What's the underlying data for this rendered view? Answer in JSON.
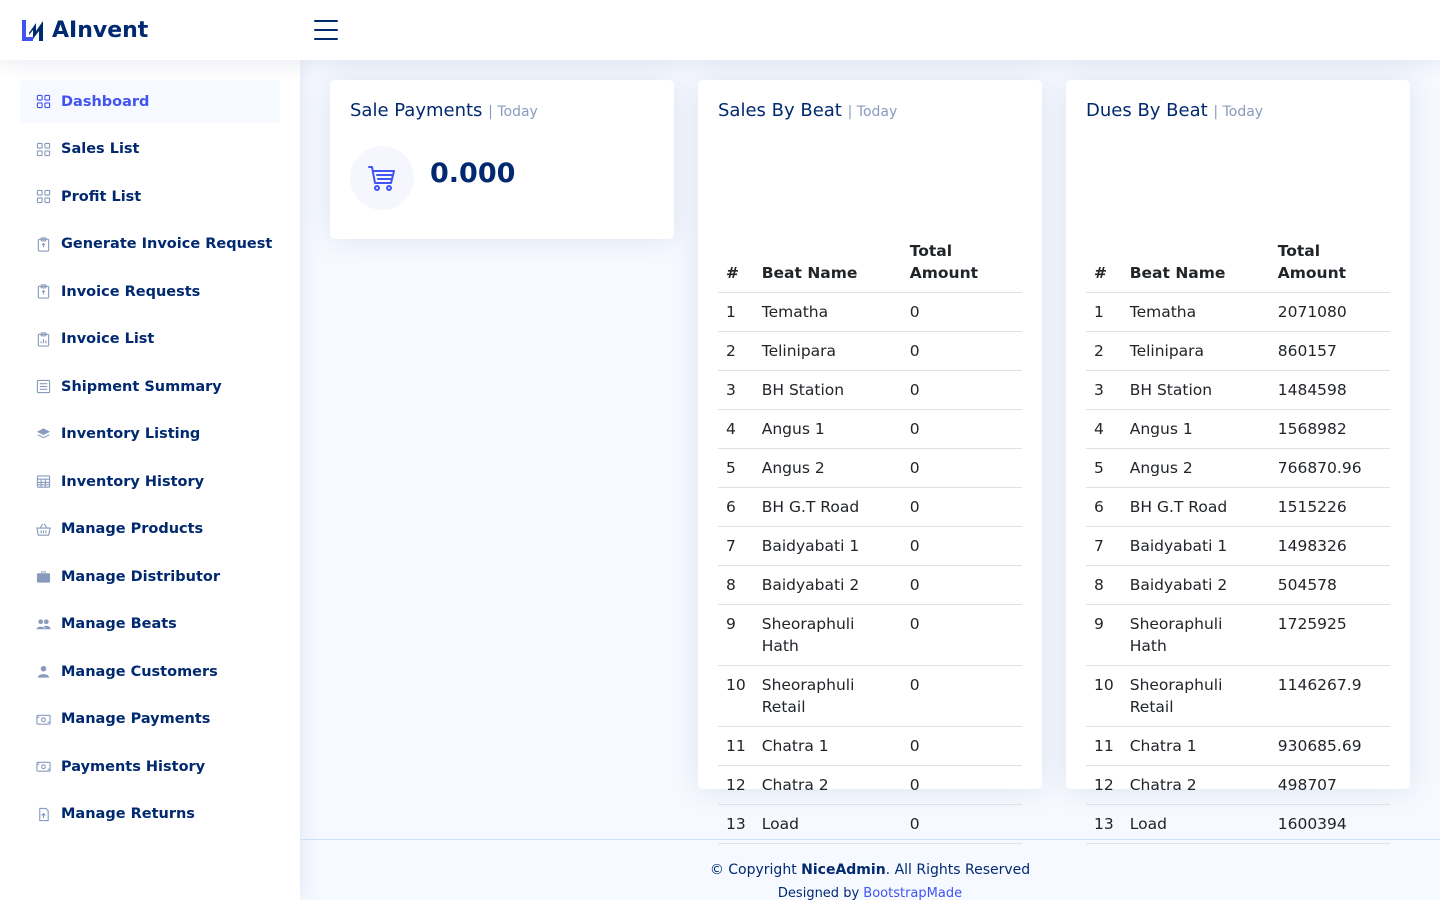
{
  "header": {
    "logo_text": "AInvent",
    "logo_icon": "logo-mark-icon",
    "toggle_icon": "menu-icon"
  },
  "sidebar": {
    "items": [
      {
        "label": "Dashboard",
        "icon": "grid-icon",
        "active": true
      },
      {
        "label": "Sales List",
        "icon": "grid-icon"
      },
      {
        "label": "Profit List",
        "icon": "grid-icon"
      },
      {
        "label": "Generate Invoice Request",
        "icon": "clipboard-icon"
      },
      {
        "label": "Invoice Requests",
        "icon": "clipboard-icon"
      },
      {
        "label": "Invoice List",
        "icon": "clipboard-chart-icon"
      },
      {
        "label": "Shipment Summary",
        "icon": "list-box-icon"
      },
      {
        "label": "Inventory Listing",
        "icon": "layers-icon"
      },
      {
        "label": "Inventory History",
        "icon": "table-icon"
      },
      {
        "label": "Manage Products",
        "icon": "basket-icon"
      },
      {
        "label": "Manage Distributor",
        "icon": "briefcase-icon"
      },
      {
        "label": "Manage Beats",
        "icon": "people-icon"
      },
      {
        "label": "Manage Customers",
        "icon": "person-icon"
      },
      {
        "label": "Manage Payments",
        "icon": "cash-icon"
      },
      {
        "label": "Payments History",
        "icon": "cash-icon"
      },
      {
        "label": "Manage Returns",
        "icon": "return-icon"
      }
    ]
  },
  "sale_payments": {
    "title": "Sale Payments",
    "period": "| Today",
    "value": "0.000",
    "icon": "cart-icon"
  },
  "sales_by_beat": {
    "title": "Sales By Beat",
    "period": "| Today",
    "headers": [
      "#",
      "Beat Name",
      "Total Amount"
    ],
    "rows": [
      [
        "1",
        "Tematha",
        "0"
      ],
      [
        "2",
        "Telinipara",
        "0"
      ],
      [
        "3",
        "BH Station",
        "0"
      ],
      [
        "4",
        "Angus 1",
        "0"
      ],
      [
        "5",
        "Angus 2",
        "0"
      ],
      [
        "6",
        "BH G.T Road",
        "0"
      ],
      [
        "7",
        "Baidyabati 1",
        "0"
      ],
      [
        "8",
        "Baidyabati 2",
        "0"
      ],
      [
        "9",
        "Sheoraphuli Hath",
        "0"
      ],
      [
        "10",
        "Sheoraphuli Retail",
        "0"
      ],
      [
        "11",
        "Chatra 1",
        "0"
      ],
      [
        "12",
        "Chatra 2",
        "0"
      ],
      [
        "13",
        "Load",
        "0"
      ]
    ]
  },
  "dues_by_beat": {
    "title": "Dues By Beat",
    "period": "| Today",
    "headers": [
      "#",
      "Beat Name",
      "Total Amount"
    ],
    "rows": [
      [
        "1",
        "Tematha",
        "2071080"
      ],
      [
        "2",
        "Telinipara",
        "860157"
      ],
      [
        "3",
        "BH Station",
        "1484598"
      ],
      [
        "4",
        "Angus 1",
        "1568982"
      ],
      [
        "5",
        "Angus 2",
        "766870.96"
      ],
      [
        "6",
        "BH G.T Road",
        "1515226"
      ],
      [
        "7",
        "Baidyabati 1",
        "1498326"
      ],
      [
        "8",
        "Baidyabati 2",
        "504578"
      ],
      [
        "9",
        "Sheoraphuli Hath",
        "1725925"
      ],
      [
        "10",
        "Sheoraphuli Retail",
        "1146267.9"
      ],
      [
        "11",
        "Chatra 1",
        "930685.69"
      ],
      [
        "12",
        "Chatra 2",
        "498707"
      ],
      [
        "13",
        "Load",
        "1600394"
      ]
    ]
  },
  "footer": {
    "copyright_prefix": "© Copyright",
    "brand": "NiceAdmin",
    "rights": ". All Rights Reserved",
    "designed_prefix": "Designed by",
    "designer": "BootstrapMade"
  },
  "colors": {
    "primary": "#4154f1",
    "heading": "#012970",
    "muted": "#899bbd",
    "background": "#f6f9ff"
  }
}
